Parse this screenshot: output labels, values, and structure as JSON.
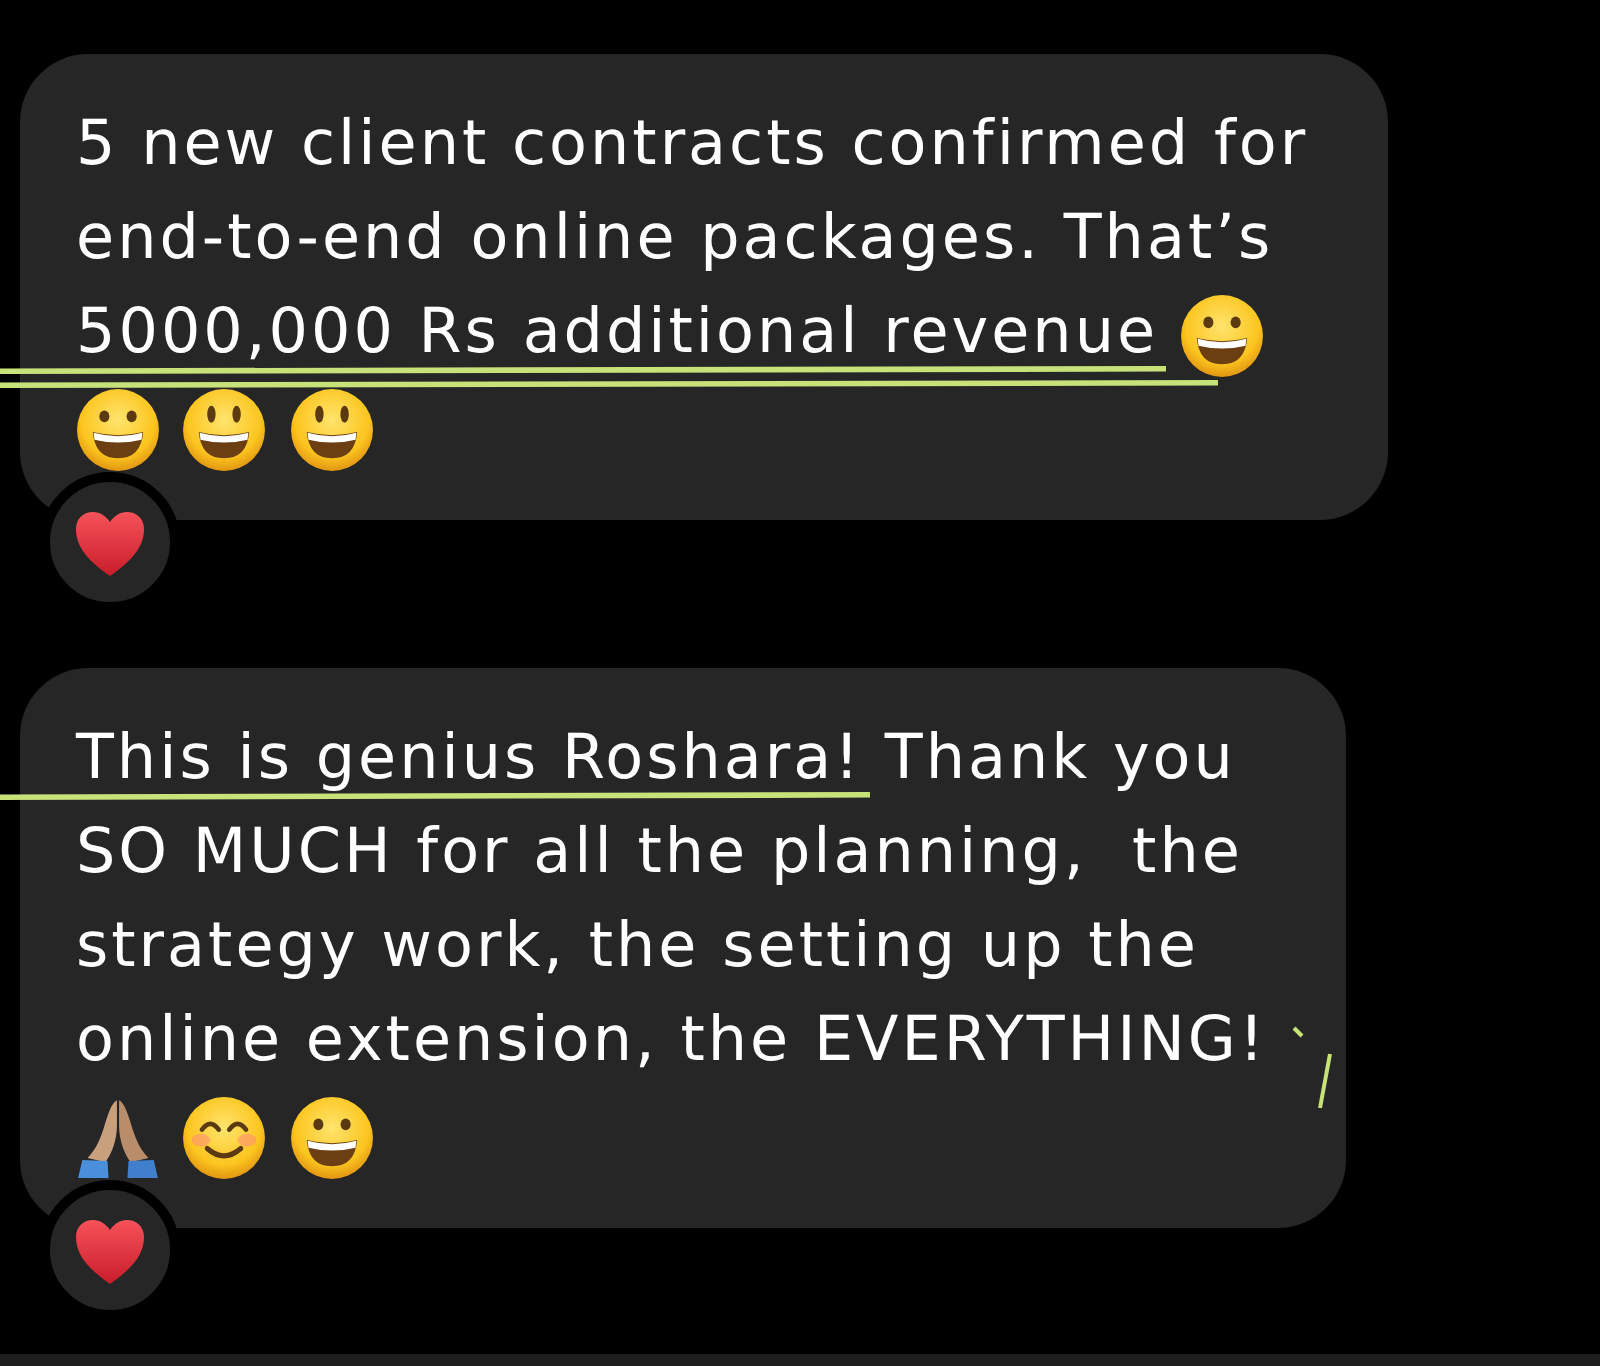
{
  "messages": [
    {
      "lines": [
        [
          {
            "text": "5 new client contracts confirmed for",
            "underlined": false,
            "double_underline": false
          }
        ],
        [
          {
            "text": "end-to-end online packages. That’s",
            "underlined": false,
            "double_underline": false
          }
        ],
        [
          {
            "text": "5000,000 Rs additional revenue",
            "underlined": true,
            "double_underline": true
          }
        ]
      ],
      "emoji": [
        {
          "kind": "grinning"
        },
        {
          "kind": "grinning"
        },
        {
          "kind": "smiley"
        },
        {
          "kind": "smiley"
        }
      ],
      "reaction": {
        "kind": "heart"
      },
      "scribble": false
    },
    {
      "lines": [
        [
          {
            "text": "This is genius Roshara!",
            "underlined": true,
            "double_underline": false
          },
          {
            "text": " Thank you",
            "underlined": false,
            "double_underline": false
          }
        ],
        [
          {
            "text": "SO MUCH for all the planning,  the",
            "underlined": false,
            "double_underline": false
          }
        ],
        [
          {
            "text": "strategy work, the setting up the",
            "underlined": false,
            "double_underline": false
          }
        ],
        [
          {
            "text": "online extension, the EVERYTHING!",
            "underlined": false,
            "double_underline": false
          }
        ]
      ],
      "emoji": [
        {
          "kind": "folded_hands"
        },
        {
          "kind": "blushing"
        },
        {
          "kind": "grinning"
        }
      ],
      "reaction": {
        "kind": "heart"
      },
      "scribble": true
    }
  ]
}
